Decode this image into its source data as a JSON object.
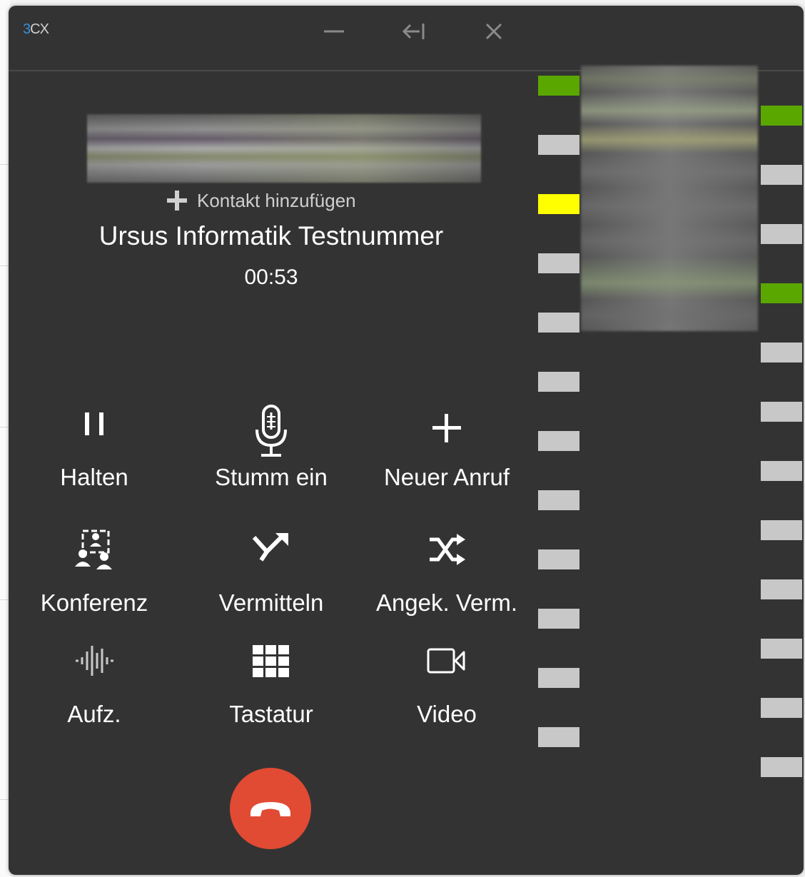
{
  "app": {
    "title_prefix": "3",
    "title_suffix": "CX"
  },
  "window_controls": {
    "minimize_icon": "minus-icon",
    "dock_icon": "arrow-left-bar-icon",
    "close_icon": "x-icon"
  },
  "call": {
    "add_contact_label": "Kontakt hinzufügen",
    "caller_name": "Ursus Informatik Testnummer",
    "duration": "00:53"
  },
  "actions": {
    "hold": {
      "label": "Halten",
      "icon": "pause-icon"
    },
    "mute": {
      "label": "Stumm ein",
      "icon": "microphone-icon"
    },
    "new_call": {
      "label": "Neuer Anruf",
      "icon": "plus-icon"
    },
    "conference": {
      "label": "Konferenz",
      "icon": "conference-icon"
    },
    "transfer": {
      "label": "Vermitteln",
      "icon": "transfer-arrow-icon"
    },
    "attended_transfer": {
      "label": "Angek. Verm.",
      "icon": "shuffle-icon"
    },
    "record": {
      "label": "Aufz.",
      "icon": "waveform-icon"
    },
    "keypad": {
      "label": "Tastatur",
      "icon": "keypad-grid-icon"
    },
    "video": {
      "label": "Video",
      "icon": "video-camera-icon"
    }
  },
  "hangup": {
    "icon": "phone-hangup-icon"
  },
  "colors": {
    "window_bg": "#333333",
    "hangup": "#e14a33",
    "presence_available": "#5aa700",
    "presence_busy": "#ffff00",
    "presence_offline": "#c8c8c8",
    "accent": "#3a8fd8"
  },
  "blf_left": [
    "available",
    "offline",
    "busy",
    "offline",
    "offline",
    "offline",
    "offline",
    "offline",
    "offline",
    "offline",
    "offline",
    "offline"
  ],
  "blf_right": [
    "available",
    "offline",
    "offline",
    "available",
    "offline",
    "offline",
    "offline",
    "offline",
    "offline",
    "offline",
    "offline",
    "offline"
  ]
}
